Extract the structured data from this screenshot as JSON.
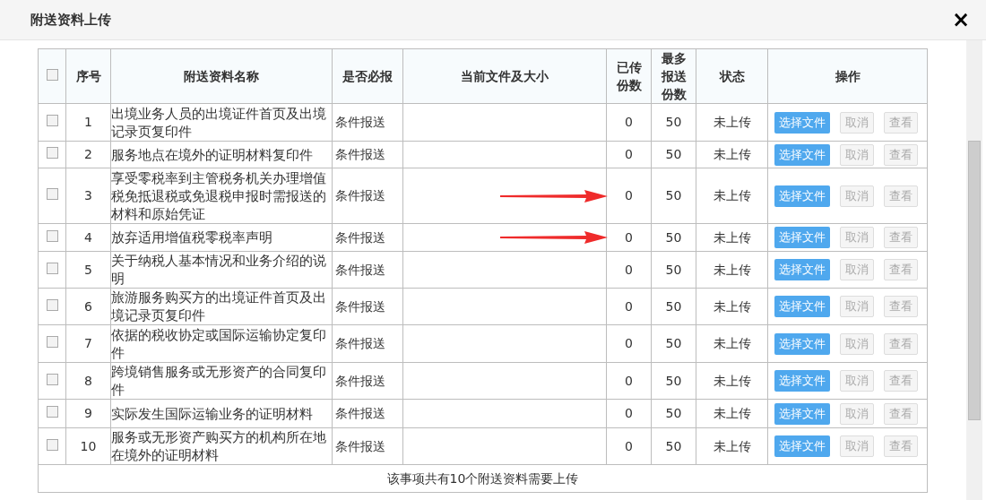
{
  "dialog": {
    "title": "附送资料上传",
    "close": "×"
  },
  "table": {
    "select_all": {
      "checked": false
    },
    "columns": [
      "序号",
      "附送资料名称",
      "是否必报",
      "当前文件及大小",
      "已传份数",
      "最多报送份数",
      "状态",
      "操作"
    ],
    "rows": [
      {
        "checked": false,
        "no": "1",
        "name": "出境业务人员的出境证件首页及出境记录页复印件",
        "required": "条件报送",
        "file": "",
        "uploaded": "0",
        "max": "50",
        "status": "未上传",
        "marked": false,
        "buttons": [
          {
            "label": "选择文件",
            "disabled": false
          },
          {
            "label": "取消",
            "disabled": true
          },
          {
            "label": "查看",
            "disabled": true
          }
        ]
      },
      {
        "checked": false,
        "no": "2",
        "name": "服务地点在境外的证明材料复印件",
        "required": "条件报送",
        "file": "",
        "uploaded": "0",
        "max": "50",
        "status": "未上传",
        "marked": false,
        "buttons": [
          {
            "label": "选择文件",
            "disabled": false
          },
          {
            "label": "取消",
            "disabled": true
          },
          {
            "label": "查看",
            "disabled": true
          }
        ]
      },
      {
        "checked": false,
        "no": "3",
        "name": "享受零税率到主管税务机关办理增值税免抵退税或免退税申报时需报送的材料和原始凭证",
        "required": "条件报送",
        "file": "",
        "uploaded": "0",
        "max": "50",
        "status": "未上传",
        "marked": true,
        "buttons": [
          {
            "label": "选择文件",
            "disabled": false
          },
          {
            "label": "取消",
            "disabled": true
          },
          {
            "label": "查看",
            "disabled": true
          }
        ]
      },
      {
        "checked": false,
        "no": "4",
        "name": "放弃适用增值税零税率声明",
        "required": "条件报送",
        "file": "",
        "uploaded": "0",
        "max": "50",
        "status": "未上传",
        "marked": true,
        "buttons": [
          {
            "label": "选择文件",
            "disabled": false
          },
          {
            "label": "取消",
            "disabled": true
          },
          {
            "label": "查看",
            "disabled": true
          }
        ]
      },
      {
        "checked": false,
        "no": "5",
        "name": "关于纳税人基本情况和业务介绍的说明",
        "required": "条件报送",
        "file": "",
        "uploaded": "0",
        "max": "50",
        "status": "未上传",
        "marked": false,
        "buttons": [
          {
            "label": "选择文件",
            "disabled": false
          },
          {
            "label": "取消",
            "disabled": true
          },
          {
            "label": "查看",
            "disabled": true
          }
        ]
      },
      {
        "checked": false,
        "no": "6",
        "name": "旅游服务购买方的出境证件首页及出境记录页复印件",
        "required": "条件报送",
        "file": "",
        "uploaded": "0",
        "max": "50",
        "status": "未上传",
        "marked": false,
        "buttons": [
          {
            "label": "选择文件",
            "disabled": false
          },
          {
            "label": "取消",
            "disabled": true
          },
          {
            "label": "查看",
            "disabled": true
          }
        ]
      },
      {
        "checked": false,
        "no": "7",
        "name": "依据的税收协定或国际运输协定复印件",
        "required": "条件报送",
        "file": "",
        "uploaded": "0",
        "max": "50",
        "status": "未上传",
        "marked": false,
        "buttons": [
          {
            "label": "选择文件",
            "disabled": false
          },
          {
            "label": "取消",
            "disabled": true
          },
          {
            "label": "查看",
            "disabled": true
          }
        ]
      },
      {
        "checked": false,
        "no": "8",
        "name": "跨境销售服务或无形资产的合同复印件",
        "required": "条件报送",
        "file": "",
        "uploaded": "0",
        "max": "50",
        "status": "未上传",
        "marked": false,
        "buttons": [
          {
            "label": "选择文件",
            "disabled": false
          },
          {
            "label": "取消",
            "disabled": true
          },
          {
            "label": "查看",
            "disabled": true
          }
        ]
      },
      {
        "checked": false,
        "no": "9",
        "name": "实际发生国际运输业务的证明材料",
        "required": "条件报送",
        "file": "",
        "uploaded": "0",
        "max": "50",
        "status": "未上传",
        "marked": false,
        "buttons": [
          {
            "label": "选择文件",
            "disabled": false
          },
          {
            "label": "取消",
            "disabled": true
          },
          {
            "label": "查看",
            "disabled": true
          }
        ]
      },
      {
        "checked": false,
        "no": "10",
        "name": "服务或无形资产购买方的机构所在地在境外的证明材料",
        "required": "条件报送",
        "file": "",
        "uploaded": "0",
        "max": "50",
        "status": "未上传",
        "marked": false,
        "buttons": [
          {
            "label": "选择文件",
            "disabled": false
          },
          {
            "label": "取消",
            "disabled": true
          },
          {
            "label": "查看",
            "disabled": true
          }
        ]
      }
    ],
    "footer": "该事项共有10个附送资料需要上传"
  }
}
